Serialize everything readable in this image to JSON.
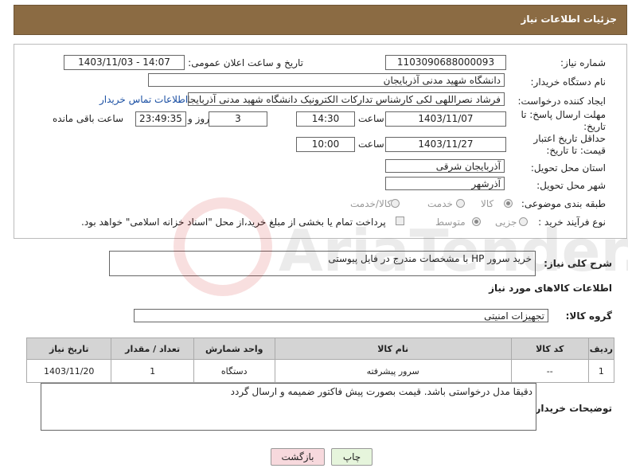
{
  "header": {
    "title": "جزئیات اطلاعات نیاز"
  },
  "fields": {
    "need_number_label": "شماره نیاز:",
    "need_number": "1103090688000093",
    "announce_label": "تاریخ و ساعت اعلان عمومی:",
    "announce_value": "1403/11/03 - 14:07",
    "buyer_org_label": "نام دستگاه خریدار:",
    "buyer_org": "دانشگاه شهید مدنی آذربایجان",
    "creator_label": "ایجاد کننده درخواست:",
    "creator": "فرشاد نصراللهی لکی کارشناس تدارکات الکترونیک دانشگاه شهید مدنی آذربایجان",
    "contact_link": "اطلاعات تماس خریدار",
    "reply_deadline_label": "مهلت ارسال پاسخ: تا تاریخ:",
    "reply_date": "1403/11/07",
    "time_label": "ساعت",
    "reply_time": "14:30",
    "days_value": "3",
    "days_label": "روز و",
    "remaining_value": "23:49:35",
    "remaining_label": "ساعت باقی مانده",
    "price_deadline_label": "حداقل تاریخ اعتبار قیمت: تا تاریخ:",
    "price_date": "1403/11/27",
    "price_time": "10:00",
    "province_label": "استان محل تحویل:",
    "province": "آذربایجان شرقی",
    "city_label": "شهر محل تحویل:",
    "city": "آذرشهر",
    "category_label": "طبقه بندی موضوعی:",
    "category_options": [
      "کالا",
      "خدمت",
      "کالا/خدمت"
    ],
    "process_label": "نوع فرآیند خرید :",
    "process_options": [
      "جزیی",
      "متوسط"
    ],
    "payment_note": "پرداخت تمام یا بخشی از مبلغ خرید،از محل \"اسناد خزانه اسلامی\" خواهد بود."
  },
  "description": {
    "label": "شرح کلی نیاز:",
    "value": "خرید سرور HP با مشخصات مندرج در فایل پیوستی"
  },
  "goods_section": {
    "title": "اطلاعات کالاهای مورد نیاز",
    "group_label": "گروه کالا:",
    "group_value": "تجهیزات امنیتی"
  },
  "table": {
    "headers": [
      "ردیف",
      "کد کالا",
      "نام کالا",
      "واحد شمارش",
      "تعداد / مقدار",
      "تاریخ نیاز"
    ],
    "rows": [
      [
        "1",
        "--",
        "سرور پیشرفته",
        "دستگاه",
        "1",
        "1403/11/20"
      ]
    ]
  },
  "buyer_notes": {
    "label": "توضیحات خریدار:",
    "value": "دقیقا مدل درخواستی باشد. قیمت بصورت پیش فاکتور ضمیمه و ارسال گردد"
  },
  "buttons": {
    "print": "چاپ",
    "back": "بازگشت"
  },
  "watermark": "AriaTender.net",
  "colors": {
    "header_bg": "#8b6b43",
    "link": "#1a4fa3",
    "back_button_bg": "#f7d9dd",
    "print_button_bg": "#e6f5dc"
  }
}
